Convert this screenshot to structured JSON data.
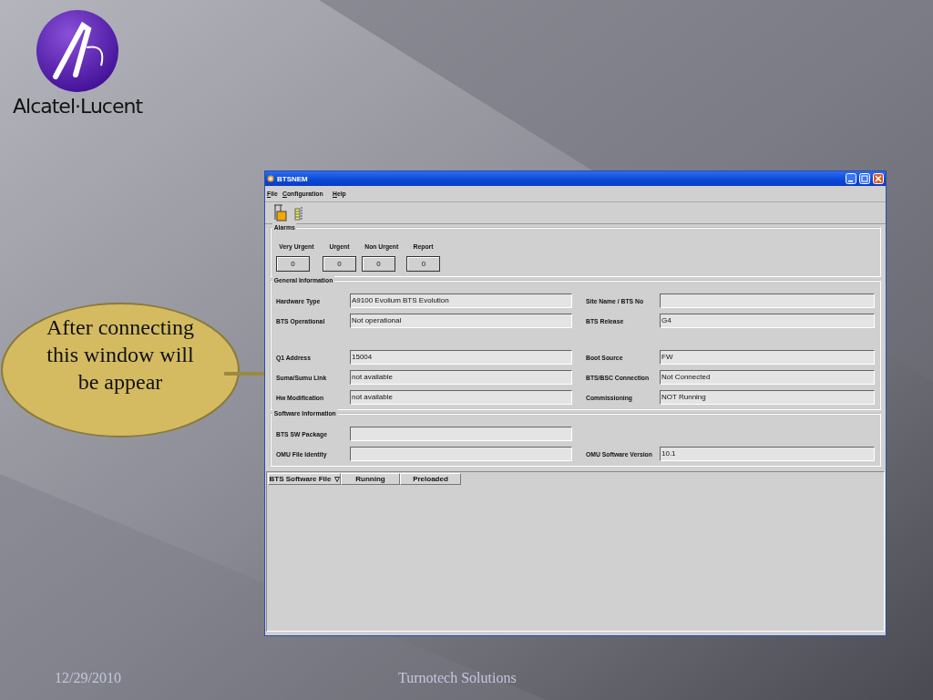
{
  "logo": {
    "wordmark": "Alcatel·Lucent"
  },
  "callout": {
    "text": "After connecting this window will be appear"
  },
  "window": {
    "title": "BTSNEM",
    "menus": [
      {
        "label": "File"
      },
      {
        "label": "Configuration"
      },
      {
        "label": "Help"
      }
    ],
    "alarms": {
      "title": "Alarms",
      "items": [
        {
          "label": "Very Urgent",
          "value": "0"
        },
        {
          "label": "Urgent",
          "value": "0"
        },
        {
          "label": "Non Urgent",
          "value": "0"
        },
        {
          "label": "Report",
          "value": "0"
        }
      ]
    },
    "general": {
      "title": "General Information",
      "blocks": [
        [
          {
            "left": {
              "label": "Hardware Type",
              "value": "A9100 Evolium BTS Evolution"
            },
            "right": {
              "label": "Site Name / BTS No"
            }
          },
          {
            "left": {
              "label": "BTS Operational",
              "value": "Not operational"
            },
            "right": {
              "label": "BTS Release",
              "value": "G4"
            }
          }
        ],
        [
          {
            "left": {
              "label": "Q1 Address",
              "value": "15004"
            },
            "right": {
              "label": "Boot Source",
              "value": "FW"
            }
          },
          {
            "left": {
              "label": "Suma/Sumu Link",
              "value": "not available"
            },
            "right": {
              "label": "BTS/BSC Connection",
              "value": "Not Connected"
            }
          },
          {
            "left": {
              "label": "Hw Modification",
              "value": "not available"
            },
            "right": {
              "label": "Commissioning",
              "value": "NOT Running"
            }
          }
        ]
      ]
    },
    "software": {
      "title": "Software Information",
      "rows": [
        {
          "left": {
            "label": "BTS SW Package"
          }
        },
        {
          "left": {
            "label": "OMU File Identity"
          },
          "right": {
            "label": "OMU Software Version",
            "value": "10.1"
          }
        }
      ]
    },
    "table": {
      "columns": [
        {
          "label": "BTS Software File",
          "sorted": true
        },
        {
          "label": "Running",
          "sorted": false
        },
        {
          "label": "Preloaded",
          "sorted": false
        }
      ]
    }
  },
  "footer": {
    "date": "12/29/2010",
    "company": "Turnotech Solutions"
  }
}
